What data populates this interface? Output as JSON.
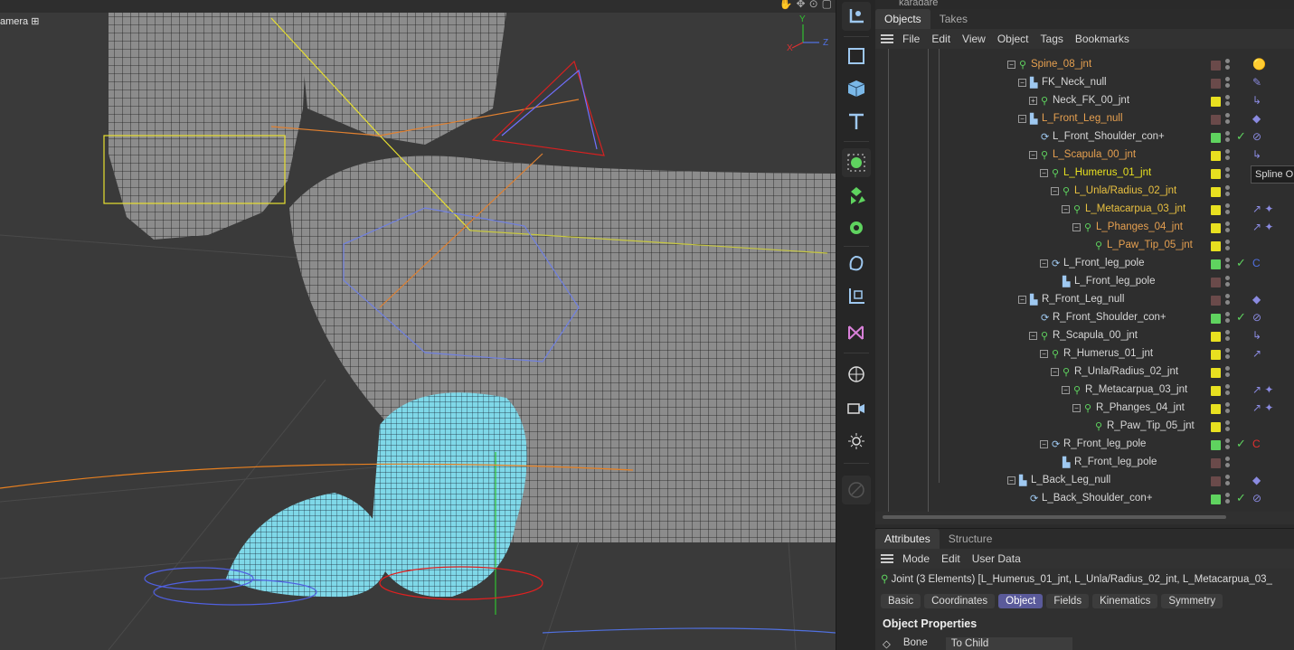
{
  "viewport": {
    "camera_label": "amera",
    "camera_icon": "camera-icon",
    "axis_x": "X",
    "axis_y": "Y",
    "axis_z": "Z"
  },
  "toolbar": {
    "tools": [
      "object-tool-icon",
      "cube-outline-icon",
      "cube-icon",
      "text-icon",
      "sphere-select-icon",
      "mograph-icon",
      "generator-icon",
      "deformer-icon",
      "tag-icon",
      "spline-icon",
      "globe-icon",
      "camera-icon",
      "light-icon",
      "disabled-icon"
    ]
  },
  "object_manager": {
    "top_object": "karadare",
    "tabs": [
      "Objects",
      "Takes"
    ],
    "menu": [
      "File",
      "Edit",
      "View",
      "Object",
      "Tags",
      "Bookmarks"
    ],
    "rows": [
      {
        "name": "Spine_08_jnt",
        "indent": 1,
        "color": "#e6a050",
        "type": "joint",
        "expander": "-",
        "swatch": "#6a4a4a",
        "tags": "🟡"
      },
      {
        "name": "FK_Neck_null",
        "indent": 2,
        "color": "#d6d6d6",
        "type": "null",
        "expander": "-",
        "swatch": "#6a4a4a",
        "tags": "✎"
      },
      {
        "name": "Neck_FK_00_jnt",
        "indent": 3,
        "color": "#d6d6d6",
        "type": "joint",
        "expander": "+",
        "swatch": "#e8e020",
        "tags": "↳"
      },
      {
        "name": "L_Front_Leg_null",
        "indent": 2,
        "color": "#e6a050",
        "type": "null",
        "expander": "-",
        "swatch": "#6a4a4a",
        "tags": "◆"
      },
      {
        "name": "L_Front_Shoulder_con+",
        "indent": 3,
        "color": "#d6d6d6",
        "type": "spline",
        "expander": "",
        "swatch": "#5fd35f",
        "check": "✓",
        "tags": "⊘"
      },
      {
        "name": "L_Scapula_00_jnt",
        "indent": 3,
        "color": "#e6a050",
        "type": "joint",
        "expander": "-",
        "swatch": "#e8e020",
        "tags": "↳"
      },
      {
        "name": "L_Humerus_01_jnt",
        "indent": 4,
        "color": "#e8e020",
        "type": "joint",
        "expander": "-",
        "swatch": "#e8e020",
        "tags": ""
      },
      {
        "name": "L_Unla/Radius_02_jnt",
        "indent": 5,
        "color": "#e8c040",
        "type": "joint",
        "expander": "-",
        "swatch": "#e8e020",
        "tags": ""
      },
      {
        "name": "L_Metacarpua_03_jnt",
        "indent": 6,
        "color": "#e8c040",
        "type": "joint",
        "expander": "-",
        "swatch": "#e8e020",
        "tags": "↗ ✦"
      },
      {
        "name": "L_Phanges_04_jnt",
        "indent": 7,
        "color": "#e6a050",
        "type": "joint",
        "expander": "-",
        "swatch": "#e8e020",
        "tags": "↗ ✦"
      },
      {
        "name": "L_Paw_Tip_05_jnt",
        "indent": 8,
        "color": "#e6a050",
        "type": "joint",
        "expander": "",
        "swatch": "#e8e020",
        "tags": ""
      },
      {
        "name": "L_Front_leg_pole",
        "indent": 4,
        "color": "#d6d6d6",
        "type": "spline",
        "expander": "-",
        "swatch": "#5fd35f",
        "check": "✓",
        "tags": "C"
      },
      {
        "name": "L_Front_leg_pole",
        "indent": 5,
        "color": "#d6d6d6",
        "type": "null",
        "expander": "",
        "swatch": "#6a4a4a",
        "tags": ""
      },
      {
        "name": "R_Front_Leg_null",
        "indent": 2,
        "color": "#d6d6d6",
        "type": "null",
        "expander": "-",
        "swatch": "#6a4a4a",
        "tags": "◆"
      },
      {
        "name": "R_Front_Shoulder_con+",
        "indent": 3,
        "color": "#d6d6d6",
        "type": "spline",
        "expander": "",
        "swatch": "#5fd35f",
        "check": "✓",
        "tags": "⊘"
      },
      {
        "name": "R_Scapula_00_jnt",
        "indent": 3,
        "color": "#d6d6d6",
        "type": "joint",
        "expander": "-",
        "swatch": "#e8e020",
        "tags": "↳"
      },
      {
        "name": "R_Humerus_01_jnt",
        "indent": 4,
        "color": "#d6d6d6",
        "type": "joint",
        "expander": "-",
        "swatch": "#e8e020",
        "tags": "↗"
      },
      {
        "name": "R_Unla/Radius_02_jnt",
        "indent": 5,
        "color": "#d6d6d6",
        "type": "joint",
        "expander": "-",
        "swatch": "#e8e020",
        "tags": ""
      },
      {
        "name": "R_Metacarpua_03_jnt",
        "indent": 6,
        "color": "#d6d6d6",
        "type": "joint",
        "expander": "-",
        "swatch": "#e8e020",
        "tags": "↗ ✦"
      },
      {
        "name": "R_Phanges_04_jnt",
        "indent": 7,
        "color": "#d6d6d6",
        "type": "joint",
        "expander": "-",
        "swatch": "#e8e020",
        "tags": "↗ ✦"
      },
      {
        "name": "R_Paw_Tip_05_jnt",
        "indent": 8,
        "color": "#d6d6d6",
        "type": "joint",
        "expander": "",
        "swatch": "#e8e020",
        "tags": ""
      },
      {
        "name": "R_Front_leg_pole",
        "indent": 4,
        "color": "#d6d6d6",
        "type": "spline",
        "expander": "-",
        "swatch": "#5fd35f",
        "check": "✓",
        "tags": "C"
      },
      {
        "name": "R_Front_leg_pole",
        "indent": 5,
        "color": "#d6d6d6",
        "type": "null",
        "expander": "",
        "swatch": "#6a4a4a",
        "tags": ""
      },
      {
        "name": "L_Back_Leg_null",
        "indent": 1,
        "color": "#d6d6d6",
        "type": "null",
        "expander": "-",
        "swatch": "#6a4a4a",
        "tags": "◆"
      },
      {
        "name": "L_Back_Shoulder_con+",
        "indent": 2,
        "color": "#d6d6d6",
        "type": "spline",
        "expander": "",
        "swatch": "#5fd35f",
        "check": "✓",
        "tags": "⊘"
      }
    ],
    "tooltip": "Spline Ol"
  },
  "attributes": {
    "tabs": [
      "Attributes",
      "Structure"
    ],
    "menu": [
      "Mode",
      "Edit",
      "User Data"
    ],
    "joint_line": "Joint (3 Elements) [L_Humerus_01_jnt, L_Unla/Radius_02_jnt, L_Metacarpua_03_",
    "prop_tabs": [
      "Basic",
      "Coordinates",
      "Object",
      "Fields",
      "Kinematics",
      "Symmetry"
    ],
    "active_prop_tab": "Object",
    "section_title": "Object Properties",
    "bone_label": "Bone",
    "bone_value": "To Child"
  }
}
